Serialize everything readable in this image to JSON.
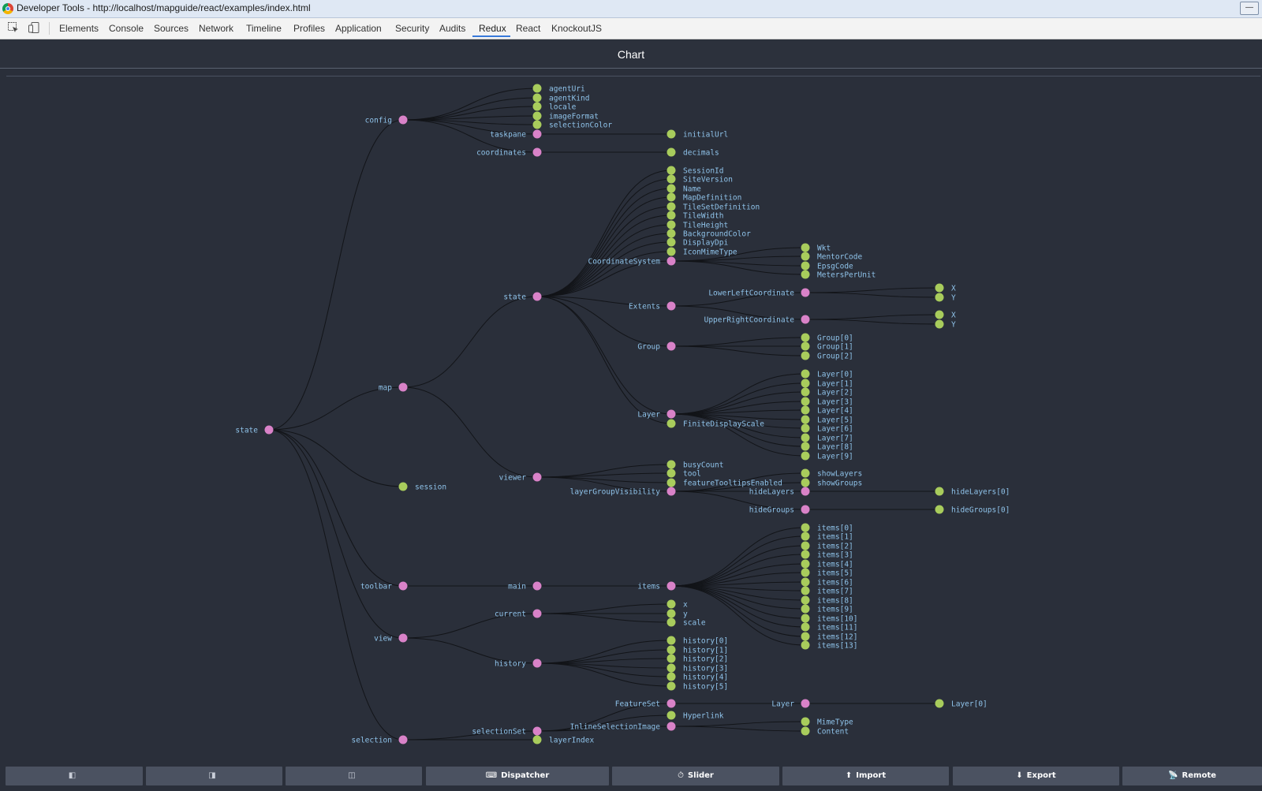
{
  "window": {
    "title": "Developer Tools - http://localhost/mapguide/react/examples/index.html"
  },
  "devtools": {
    "tabs": [
      "Elements",
      "Console",
      "Sources",
      "Network",
      "Timeline",
      "Profiles",
      "Application",
      "Security",
      "Audits",
      "Redux",
      "React",
      "KnockoutJS"
    ],
    "active_tab": "Redux"
  },
  "panel": {
    "title": "Chart"
  },
  "colors": {
    "branch_node": "#d982c8",
    "leaf_node": "#a8cc5c",
    "label": "#8fc3ea",
    "link": "#121418",
    "background": "#2a2f3a"
  },
  "tree": {
    "name": "state",
    "children": [
      {
        "name": "config",
        "children": [
          {
            "name": "agentUri"
          },
          {
            "name": "agentKind"
          },
          {
            "name": "locale"
          },
          {
            "name": "imageFormat"
          },
          {
            "name": "selectionColor"
          },
          {
            "name": "taskpane",
            "children": [
              {
                "name": "initialUrl"
              }
            ]
          },
          {
            "name": "coordinates",
            "children": [
              {
                "name": "decimals"
              }
            ]
          }
        ]
      },
      {
        "name": "map",
        "children": [
          {
            "name": "state",
            "children": [
              {
                "name": "SessionId"
              },
              {
                "name": "SiteVersion"
              },
              {
                "name": "Name"
              },
              {
                "name": "MapDefinition"
              },
              {
                "name": "TileSetDefinition"
              },
              {
                "name": "TileWidth"
              },
              {
                "name": "TileHeight"
              },
              {
                "name": "BackgroundColor"
              },
              {
                "name": "DisplayDpi"
              },
              {
                "name": "IconMimeType"
              },
              {
                "name": "CoordinateSystem",
                "children": [
                  {
                    "name": "Wkt"
                  },
                  {
                    "name": "MentorCode"
                  },
                  {
                    "name": "EpsgCode"
                  },
                  {
                    "name": "MetersPerUnit"
                  }
                ]
              },
              {
                "name": "Extents",
                "children": [
                  {
                    "name": "LowerLeftCoordinate",
                    "children": [
                      {
                        "name": "X"
                      },
                      {
                        "name": "Y"
                      }
                    ]
                  },
                  {
                    "name": "UpperRightCoordinate",
                    "children": [
                      {
                        "name": "X"
                      },
                      {
                        "name": "Y"
                      }
                    ]
                  }
                ]
              },
              {
                "name": "Group",
                "children": [
                  {
                    "name": "Group[0]"
                  },
                  {
                    "name": "Group[1]"
                  },
                  {
                    "name": "Group[2]"
                  }
                ]
              },
              {
                "name": "Layer",
                "children": [
                  {
                    "name": "Layer[0]"
                  },
                  {
                    "name": "Layer[1]"
                  },
                  {
                    "name": "Layer[2]"
                  },
                  {
                    "name": "Layer[3]"
                  },
                  {
                    "name": "Layer[4]"
                  },
                  {
                    "name": "Layer[5]"
                  },
                  {
                    "name": "Layer[6]"
                  },
                  {
                    "name": "Layer[7]"
                  },
                  {
                    "name": "Layer[8]"
                  },
                  {
                    "name": "Layer[9]"
                  }
                ]
              },
              {
                "name": "FiniteDisplayScale"
              }
            ]
          },
          {
            "name": "viewer",
            "children": [
              {
                "name": "busyCount"
              },
              {
                "name": "tool"
              },
              {
                "name": "featureTooltipsEnabled"
              },
              {
                "name": "layerGroupVisibility",
                "children": [
                  {
                    "name": "showLayers"
                  },
                  {
                    "name": "showGroups"
                  },
                  {
                    "name": "hideLayers",
                    "children": [
                      {
                        "name": "hideLayers[0]"
                      }
                    ]
                  },
                  {
                    "name": "hideGroups",
                    "children": [
                      {
                        "name": "hideGroups[0]"
                      }
                    ]
                  }
                ]
              }
            ]
          }
        ]
      },
      {
        "name": "session"
      },
      {
        "name": "toolbar",
        "children": [
          {
            "name": "main",
            "children": [
              {
                "name": "items",
                "children": [
                  {
                    "name": "items[0]"
                  },
                  {
                    "name": "items[1]"
                  },
                  {
                    "name": "items[2]"
                  },
                  {
                    "name": "items[3]"
                  },
                  {
                    "name": "items[4]"
                  },
                  {
                    "name": "items[5]"
                  },
                  {
                    "name": "items[6]"
                  },
                  {
                    "name": "items[7]"
                  },
                  {
                    "name": "items[8]"
                  },
                  {
                    "name": "items[9]"
                  },
                  {
                    "name": "items[10]"
                  },
                  {
                    "name": "items[11]"
                  },
                  {
                    "name": "items[12]"
                  },
                  {
                    "name": "items[13]"
                  }
                ]
              }
            ]
          }
        ]
      },
      {
        "name": "view",
        "children": [
          {
            "name": "current",
            "children": [
              {
                "name": "x"
              },
              {
                "name": "y"
              },
              {
                "name": "scale"
              }
            ]
          },
          {
            "name": "history",
            "children": [
              {
                "name": "history[0]"
              },
              {
                "name": "history[1]"
              },
              {
                "name": "history[2]"
              },
              {
                "name": "history[3]"
              },
              {
                "name": "history[4]"
              },
              {
                "name": "history[5]"
              }
            ]
          }
        ]
      },
      {
        "name": "selection",
        "children": [
          {
            "name": "selectionSet",
            "children": [
              {
                "name": "FeatureSet",
                "children": [
                  {
                    "name": "Layer",
                    "children": [
                      {
                        "name": "Layer[0]"
                      }
                    ]
                  }
                ]
              },
              {
                "name": "Hyperlink"
              },
              {
                "name": "InlineSelectionImage",
                "children": [
                  {
                    "name": "MimeType"
                  },
                  {
                    "name": "Content"
                  }
                ]
              }
            ]
          },
          {
            "name": "layerIndex"
          }
        ]
      }
    ]
  },
  "bottom_bar": {
    "buttons": [
      {
        "label": "",
        "icon": "layout-left-icon"
      },
      {
        "label": "",
        "icon": "layout-right-icon"
      },
      {
        "label": "",
        "icon": "layout-bottom-icon"
      },
      {
        "label": "Dispatcher",
        "icon": "keyboard-icon"
      },
      {
        "label": "Slider",
        "icon": "timer-icon"
      },
      {
        "label": "Import",
        "icon": "upload-icon"
      },
      {
        "label": "Export",
        "icon": "download-icon"
      },
      {
        "label": "Remote",
        "icon": "broadcast-icon"
      }
    ]
  }
}
